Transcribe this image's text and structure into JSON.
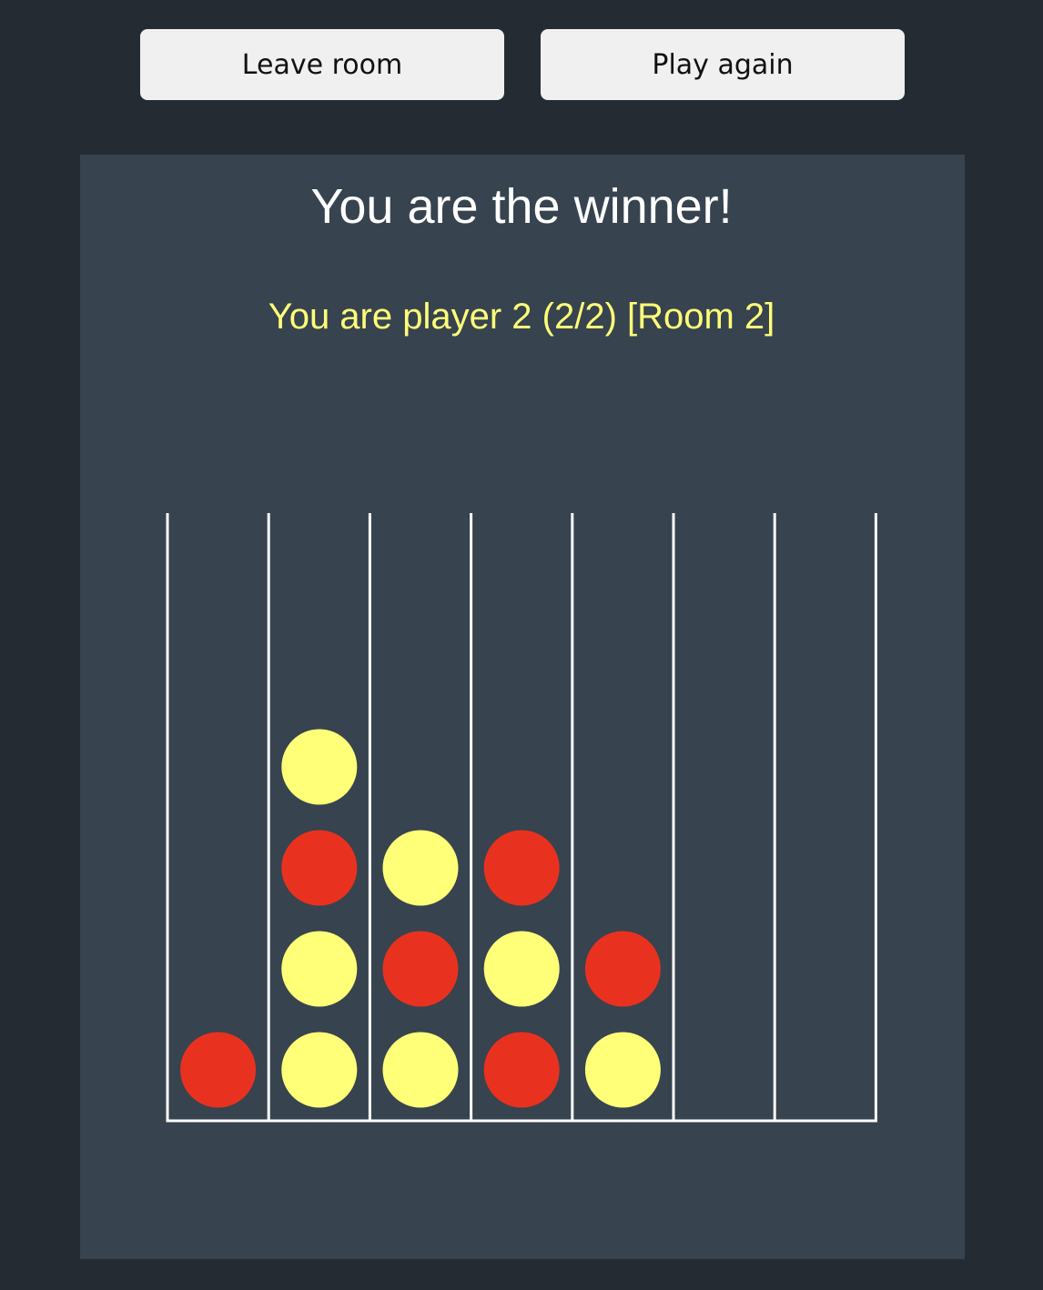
{
  "buttons": {
    "leave_label": "Leave room",
    "again_label": "Play again"
  },
  "game": {
    "result_text": "You are the winner!",
    "status_text": "You are player 2 (2/2) [Room 2]",
    "columns": 7,
    "rows": 6,
    "colors": {
      "red": "#e8321f",
      "yellow": "#ffff78",
      "lines": "#ffffff",
      "panel": "#37434e",
      "background": "#252b33"
    },
    "board": [
      [
        ".",
        ".",
        ".",
        ".",
        ".",
        ".",
        "."
      ],
      [
        ".",
        ".",
        ".",
        ".",
        ".",
        ".",
        "."
      ],
      [
        ".",
        "Y",
        ".",
        ".",
        ".",
        ".",
        "."
      ],
      [
        ".",
        "R",
        "Y",
        "R",
        ".",
        ".",
        "."
      ],
      [
        ".",
        "Y",
        "R",
        "Y",
        "R",
        ".",
        "."
      ],
      [
        "R",
        "Y",
        "Y",
        "R",
        "Y",
        ".",
        "."
      ]
    ]
  }
}
